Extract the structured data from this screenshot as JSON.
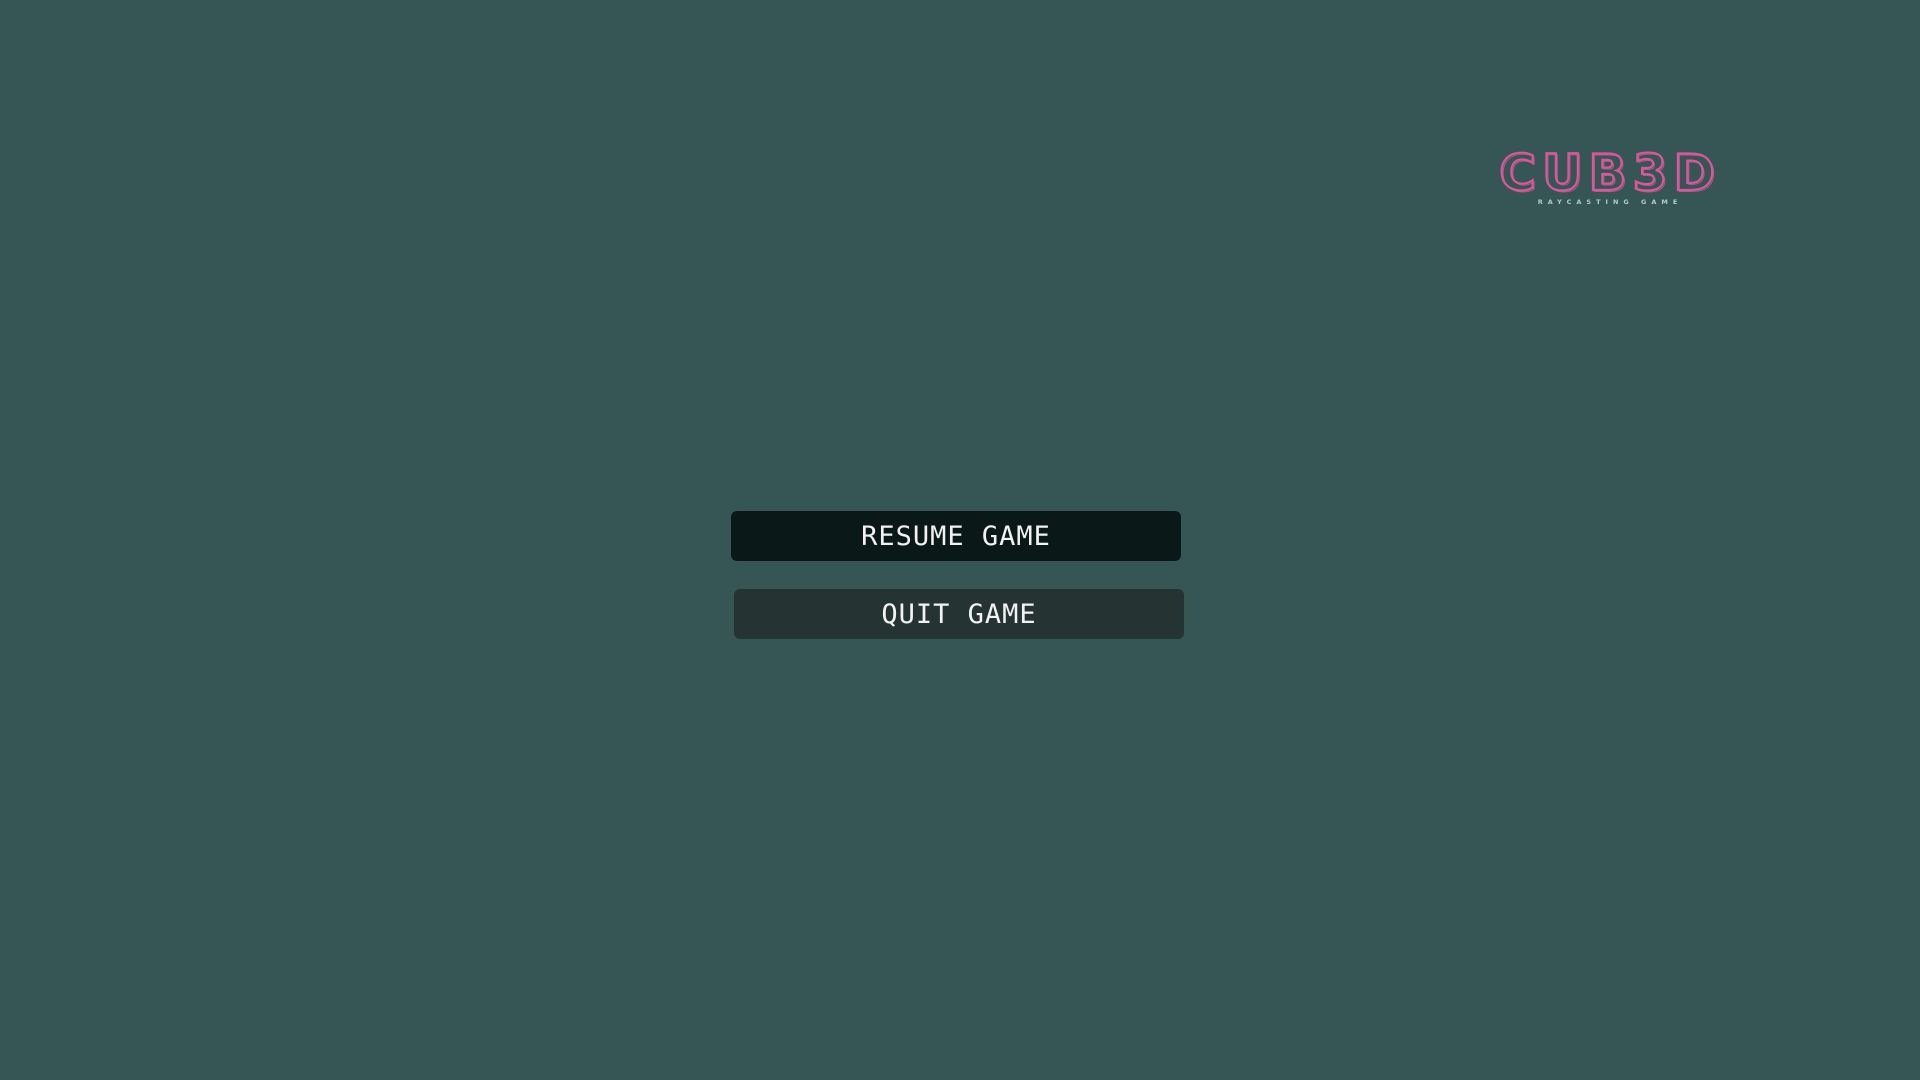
{
  "logo": {
    "title": "CUB3D",
    "subtitle": "RAYCASTING GAME",
    "color": "#d9579a",
    "subtitle_color": "#b8c9c9"
  },
  "pause_menu": {
    "resume_label": "RESUME GAME",
    "quit_label": "QUIT GAME"
  },
  "colors": {
    "background": "#365656",
    "resume_button": "#0b1818",
    "quit_button": "#263333",
    "button_text": "#f2f2f2"
  }
}
